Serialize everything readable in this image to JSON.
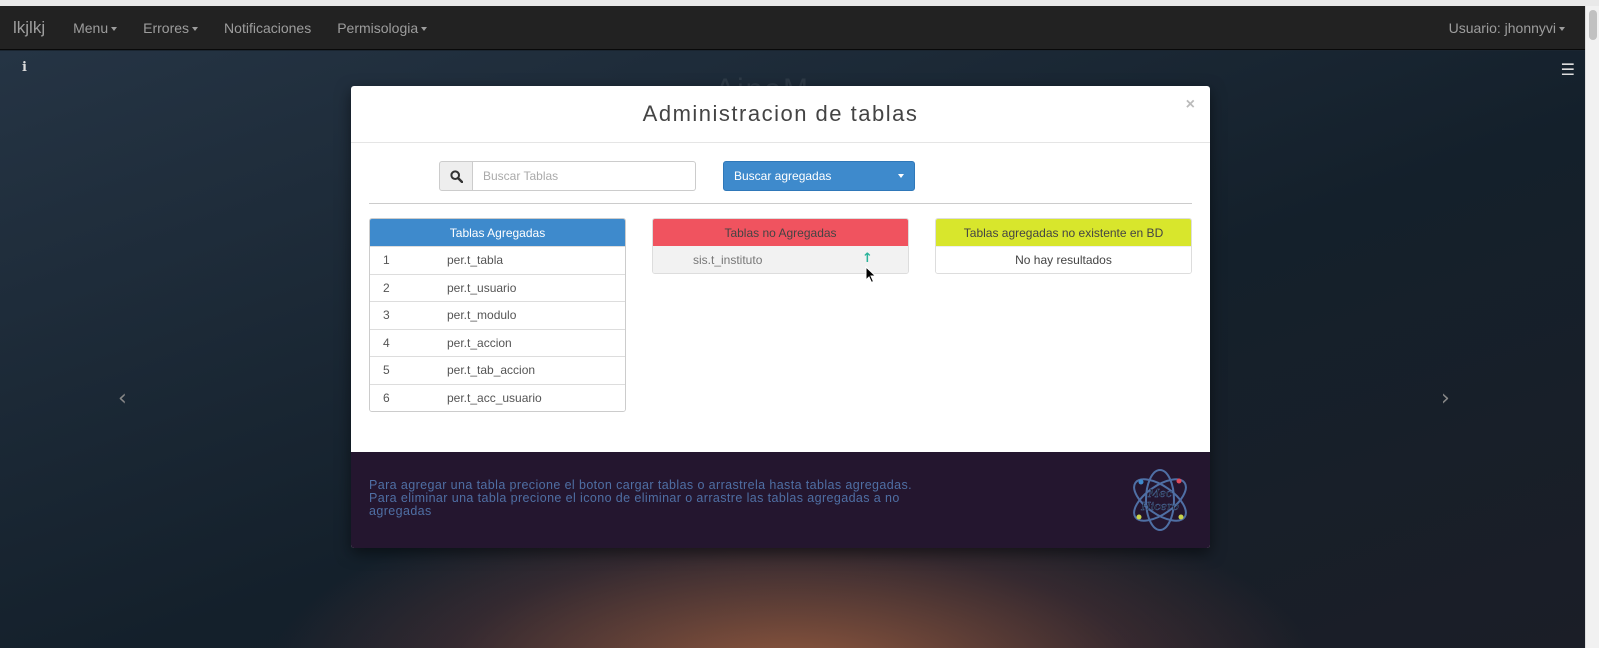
{
  "navbar": {
    "brand": "lkjlkj",
    "items": [
      {
        "label": "Menu",
        "dropdown": true
      },
      {
        "label": "Errores",
        "dropdown": true
      },
      {
        "label": "Notificaciones",
        "dropdown": false
      },
      {
        "label": "Permisologia",
        "dropdown": true
      }
    ],
    "user": "Usuario: jhonnyvi"
  },
  "background": {
    "title": "AinaM",
    "info_icon": "i",
    "menu_icon": "☰",
    "prev_arrow": "‹",
    "next_arrow": "›"
  },
  "modal": {
    "title": "Administracion de tablas",
    "close": "×",
    "search": {
      "placeholder": "Buscar Tablas",
      "value": ""
    },
    "dropdown_label": "Buscar agregadas",
    "panel_added": {
      "title": "Tablas Agregadas",
      "rows": [
        {
          "num": "1",
          "name": "per.t_tabla"
        },
        {
          "num": "2",
          "name": "per.t_usuario"
        },
        {
          "num": "3",
          "name": "per.t_modulo"
        },
        {
          "num": "4",
          "name": "per.t_accion"
        },
        {
          "num": "5",
          "name": "per.t_tab_accion"
        },
        {
          "num": "6",
          "name": "per.t_acc_usuario"
        }
      ]
    },
    "panel_not_added": {
      "title": "Tablas no Agregadas",
      "rows": [
        {
          "name": "sis.t_instituto",
          "action_icon": "↑"
        }
      ]
    },
    "panel_missing": {
      "title": "Tablas agregadas no existente en BD",
      "empty_text": "No hay resultados"
    },
    "footer": {
      "text": "Para agregar una tabla precione el boton cargar tablas o arrastrela hasta tablas agregadas. Para eliminar una tabla precione el icono de eliminar o arrastre las tablas agregadas a no agregadas",
      "logo_text": "Mec Hicero"
    }
  },
  "colors": {
    "primary": "#3e8acc",
    "danger": "#f0535f",
    "warning": "#d8e62c",
    "success": "#2bb39a",
    "footer_bg": "#24162f"
  }
}
